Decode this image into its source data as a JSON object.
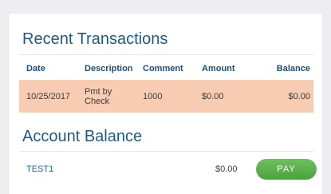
{
  "recent_transactions": {
    "title": "Recent Transactions",
    "columns": {
      "date": "Date",
      "description": "Description",
      "comment": "Comment",
      "amount": "Amount",
      "balance": "Balance"
    },
    "rows": [
      {
        "date": "10/25/2017",
        "description": "Pmt by Check",
        "comment": "1000",
        "amount": "$0.00",
        "balance": "$0.00",
        "highlight_color": "#f8cbb3"
      }
    ]
  },
  "account_balance": {
    "title": "Account Balance",
    "accounts": [
      {
        "name": "TEST1",
        "amount": "$0.00",
        "action_label": "PAY"
      }
    ]
  },
  "colors": {
    "heading": "#1d5a84",
    "pay_button": "#5cb24c",
    "row_highlight": "#f8cbb3"
  }
}
